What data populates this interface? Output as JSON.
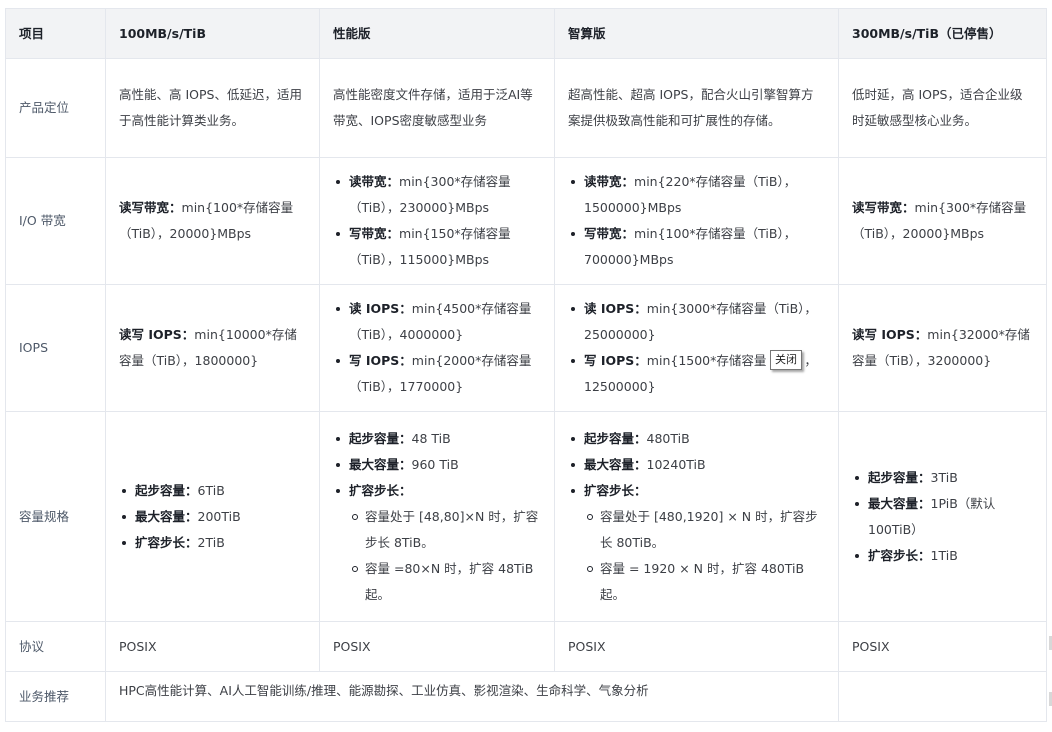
{
  "headers": [
    "项目",
    "100MB/s/TiB",
    "性能版",
    "智算版",
    "300MB/s/TiB（已停售）"
  ],
  "rows": {
    "positioning": {
      "label": "产品定位",
      "c1": "高性能、高 IOPS、低延迟，适用于高性能计算类业务。",
      "c2": "高性能密度文件存储，适用于泛AI等带宽、IOPS密度敏感型业务",
      "c3": "超高性能、超高 IOPS，配合火山引擎智算方案提供极致高性能和可扩展性的存储。",
      "c4": "低时延，高 IOPS，适合企业级时延敏感型核心业务。"
    },
    "bandwidth": {
      "label": "I/O 带宽",
      "c1": {
        "k": "读写带宽：",
        "v": "min{100*存储容量（TiB），20000}MBps"
      },
      "c2": [
        {
          "k": "读带宽：",
          "v": "min{300*存储容量（TiB），230000}MBps"
        },
        {
          "k": "写带宽：",
          "v": "min{150*存储容量（TiB），115000}MBps"
        }
      ],
      "c3": [
        {
          "k": "读带宽：",
          "v": "min{220*存储容量（TiB），1500000}MBps"
        },
        {
          "k": "写带宽：",
          "v": "min{100*存储容量（TiB），700000}MBps"
        }
      ],
      "c4": {
        "k": "读写带宽：",
        "v": "min{300*存储容量（TiB），20000}MBps"
      }
    },
    "iops": {
      "label": "IOPS",
      "c1": {
        "k": "读写 IOPS：",
        "v": "min{10000*存储容量（TiB），1800000}"
      },
      "c2": [
        {
          "k": "读 IOPS：",
          "v": "min{4500*存储容量（TiB），4000000}"
        },
        {
          "k": "写 IOPS：",
          "v": "min{2000*存储容量（TiB），1770000}"
        }
      ],
      "c3": [
        {
          "k": "读 IOPS：",
          "v": "min{3000*存储容量（TiB），25000000}"
        },
        {
          "k": "写 IOPS：",
          "v": "min{1500*存储容量（TiB），12500000}"
        }
      ],
      "c4": {
        "k": "读写 IOPS：",
        "v": "min{32000*存储容量（TiB），3200000}"
      }
    },
    "capacity": {
      "label": "容量规格",
      "c1": [
        {
          "k": "起步容量：",
          "v": "6TiB"
        },
        {
          "k": "最大容量：",
          "v": "200TiB"
        },
        {
          "k": "扩容步长：",
          "v": "2TiB"
        }
      ],
      "c2": {
        "start": {
          "k": "起步容量：",
          "v": "48 TiB"
        },
        "max": {
          "k": "最大容量：",
          "v": "960 TiB"
        },
        "step": {
          "k": "扩容步长：",
          "v": ""
        },
        "sub": [
          "容量处于 [48,80]×N 时，扩容步长 8TiB。",
          "容量 =80×N 时，扩容 48TiB 起。"
        ]
      },
      "c3": {
        "start": {
          "k": "起步容量：",
          "v": "480TiB"
        },
        "max": {
          "k": "最大容量：",
          "v": "10240TiB"
        },
        "step": {
          "k": "扩容步长：",
          "v": ""
        },
        "sub": [
          "容量处于 [480,1920] × N 时，扩容步长 80TiB。",
          "容量 = 1920 × N 时，扩容 480TiB 起。"
        ]
      },
      "c4": [
        {
          "k": "起步容量：",
          "v": "3TiB"
        },
        {
          "k": "最大容量：",
          "v": "1PiB（默认100TiB）"
        },
        {
          "k": "扩容步长：",
          "v": "1TiB"
        }
      ]
    },
    "protocol": {
      "label": "协议",
      "c1": "POSIX",
      "c2": "POSIX",
      "c3": "POSIX",
      "c4": "POSIX"
    },
    "scenario": {
      "label": "业务推荐",
      "c1": "HPC高性能计算、AI人工智能训练/推理、能源勘探、工业仿真、影视渲染、生命科学、气象分析",
      "c4": ""
    }
  },
  "tooltip": "关闭"
}
